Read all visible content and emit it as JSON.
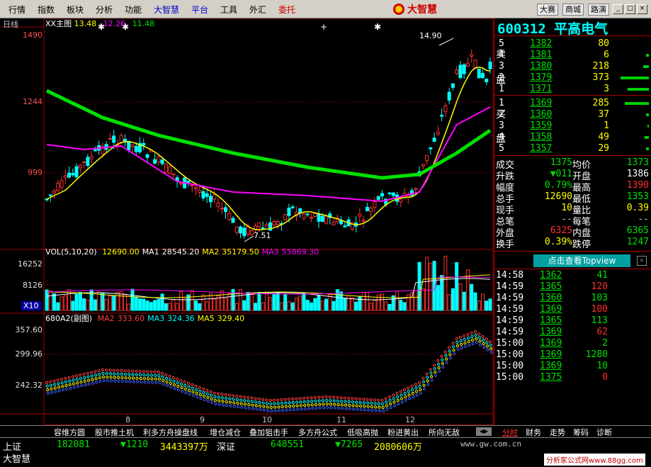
{
  "menu": [
    "行情",
    "指数",
    "板块",
    "分析",
    "功能",
    "大智慧",
    "平台",
    "工具",
    "外汇",
    "委托"
  ],
  "brand": "大智慧",
  "toolbar": [
    "大赛",
    "商城",
    "路演"
  ],
  "window_buttons": [
    "_",
    "□",
    "×"
  ],
  "chart": {
    "period_label": "日线",
    "main_title": "XX主图",
    "main_values": [
      "13.48",
      "12.26",
      "11.48"
    ],
    "price_axis": [
      "1490",
      "1244",
      "999"
    ],
    "high_label": "14.90",
    "low_label": "7.51",
    "vol_title": "VOL(5,10,20)",
    "vol_values": [
      {
        "label": "12690.00",
        "color": "#ffff00"
      },
      {
        "label": "MA1",
        "color": "#ffffff"
      },
      {
        "label": "28545.20",
        "color": "#ffffff"
      },
      {
        "label": "MA2",
        "color": "#ffff00"
      },
      {
        "label": "35179.50",
        "color": "#ffff00"
      },
      {
        "label": "MA3",
        "color": "#ff00ff"
      },
      {
        "label": "55869.30",
        "color": "#ff00ff"
      }
    ],
    "vol_axis": [
      "16252",
      "8126"
    ],
    "vol_unit": "X10",
    "ind_title": "680A2(副图)",
    "ind_values": [
      {
        "label": "MA2",
        "color": "#ff4040"
      },
      {
        "label": "333.60",
        "color": "#ff4040"
      },
      {
        "label": "MA3",
        "color": "#00ffff"
      },
      {
        "label": "324.36",
        "color": "#00ffff"
      },
      {
        "label": "MA5",
        "color": "#ffff00"
      },
      {
        "label": "329.40",
        "color": "#ffff00"
      }
    ],
    "ind_axis": [
      "357.60",
      "299.96",
      "242.32"
    ],
    "x_labels": [
      "8",
      "9",
      "10",
      "11",
      "12"
    ]
  },
  "quote": {
    "code": "600312",
    "name": "平高电气",
    "sell_label": [
      "卖",
      "盘"
    ],
    "buy_label": [
      "买",
      "盘"
    ],
    "asks": [
      {
        "level": "5",
        "price": "1382",
        "vol": "80"
      },
      {
        "level": "4",
        "price": "1381",
        "vol": "6"
      },
      {
        "level": "3",
        "price": "1380",
        "vol": "218"
      },
      {
        "level": "2",
        "price": "1379",
        "vol": "373"
      },
      {
        "level": "1",
        "price": "1371",
        "vol": "3"
      }
    ],
    "bids": [
      {
        "level": "1",
        "price": "1369",
        "vol": "285"
      },
      {
        "level": "2",
        "price": "1360",
        "vol": "37"
      },
      {
        "level": "3",
        "price": "1359",
        "vol": "1"
      },
      {
        "level": "4",
        "price": "1358",
        "vol": "49"
      },
      {
        "level": "5",
        "price": "1357",
        "vol": "29"
      }
    ],
    "stats": [
      {
        "l1": "成交",
        "v1": "1375",
        "c1": "c-green",
        "l2": "均价",
        "v2": "1373",
        "c2": "c-green"
      },
      {
        "l1": "升跌",
        "v1": "▼011",
        "c1": "c-green",
        "l2": "开盘",
        "v2": "1386",
        "c2": "c-white"
      },
      {
        "l1": "幅度",
        "v1": "0.79%",
        "c1": "c-green",
        "l2": "最高",
        "v2": "1390",
        "c2": "c-red"
      },
      {
        "l1": "总手",
        "v1": "12690",
        "c1": "c-yellow",
        "l2": "最低",
        "v2": "1353",
        "c2": "c-green"
      },
      {
        "l1": "现手",
        "v1": "10",
        "c1": "c-yellow",
        "l2": "量比",
        "v2": "0.39",
        "c2": "c-yellow"
      },
      {
        "l1": "总笔",
        "v1": "--",
        "c1": "c-gray",
        "l2": "每笔",
        "v2": "--",
        "c2": "c-gray"
      },
      {
        "l1": "外盘",
        "v1": "6325",
        "c1": "c-red",
        "l2": "内盘",
        "v2": "6365",
        "c2": "c-green"
      },
      {
        "l1": "换手",
        "v1": "0.39%",
        "c1": "c-yellow",
        "l2": "跌停",
        "v2": "1247",
        "c2": "c-green"
      }
    ],
    "topview_label": "点击查看Topview",
    "ticks": [
      {
        "time": "14:58",
        "price": "1362",
        "vol": "41",
        "vc": "c-green"
      },
      {
        "time": "14:59",
        "price": "1365",
        "vol": "120",
        "vc": "c-red"
      },
      {
        "time": "14:59",
        "price": "1360",
        "vol": "103",
        "vc": "c-green"
      },
      {
        "time": "14:59",
        "price": "1369",
        "vol": "100",
        "vc": "c-red"
      },
      {
        "time": "14:59",
        "price": "1365",
        "vol": "113",
        "vc": "c-green"
      },
      {
        "time": "14:59",
        "price": "1369",
        "vol": "62",
        "vc": "c-red"
      },
      {
        "time": "15:00",
        "price": "1369",
        "vol": "2",
        "vc": "c-green"
      },
      {
        "time": "15:00",
        "price": "1369",
        "vol": "1280",
        "vc": "c-green"
      },
      {
        "time": "15:00",
        "price": "1369",
        "vol": "10",
        "vc": "c-green"
      },
      {
        "time": "15:00",
        "price": "1375",
        "vol": "0",
        "vc": "c-red"
      }
    ]
  },
  "bottom_tabs": [
    "容维方圆",
    "股市推土机",
    "利多方舟操盘线",
    "增仓减仓",
    "叠加狙击手",
    "多方舟公式",
    "低吸高抛",
    "粉进黄出",
    "所向无敌"
  ],
  "side_tabs": [
    "分时",
    "财务",
    "走势",
    "筹码",
    "诊断"
  ],
  "status": {
    "sh_label": "上证",
    "sh_value": "182081",
    "sh_change": "▼1210",
    "sh_amount": "3443397万",
    "sz_label": "深证",
    "sz_value": "648551",
    "sz_change": "▼7265",
    "sz_amount": "2080606万",
    "brand2": "大智慧",
    "url": "www.gw.com.cn",
    "watermark": "分析家公式网www.88gg.com"
  }
}
